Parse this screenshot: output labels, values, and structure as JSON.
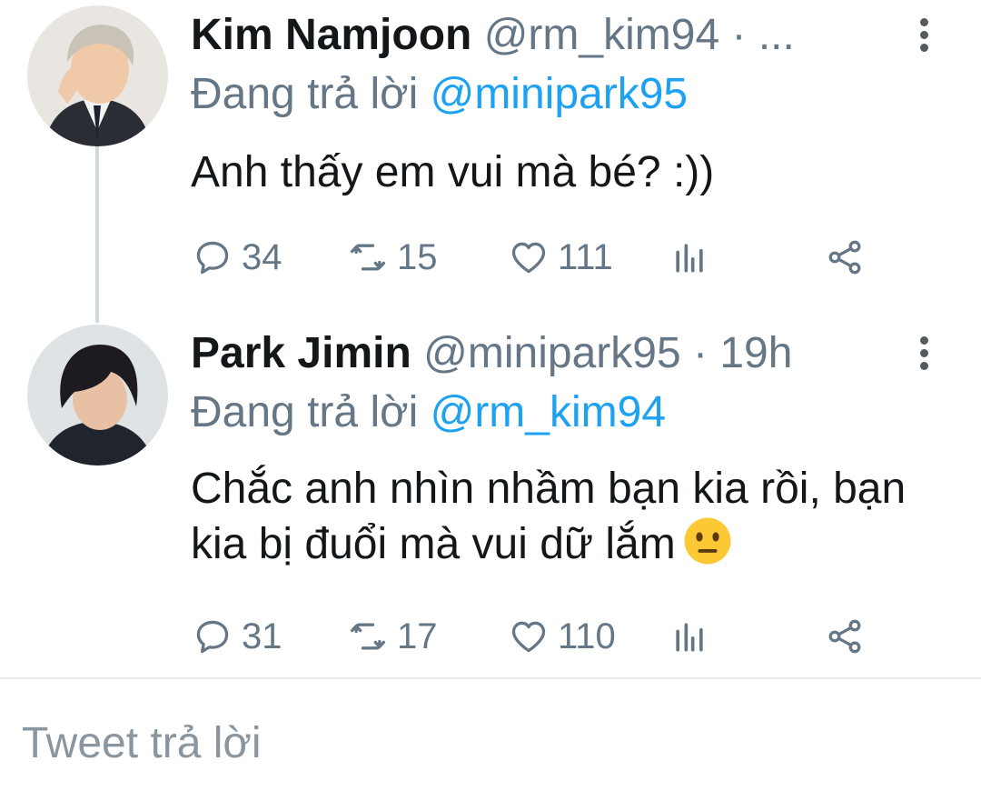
{
  "tweets": [
    {
      "name": "Kim Namjoon",
      "handle": "@rm_kim94",
      "separator": "·",
      "time": "...",
      "replying_prefix": "Đang trả lời",
      "replying_to": "@minipark95",
      "text": "Anh thấy em vui mà bé? :))",
      "replies": "34",
      "retweets": "15",
      "likes": "111"
    },
    {
      "name": "Park Jimin",
      "handle": "@minipark95",
      "separator": "·",
      "time": "19h",
      "replying_prefix": "Đang trả lời",
      "replying_to": "@rm_kim94",
      "text": "Chắc anh nhìn nhầm bạn kia rồi, bạn kia bị đuổi mà vui dữ lắm",
      "emoji": "neutral-face-emoji",
      "replies": "31",
      "retweets": "17",
      "likes": "110"
    }
  ],
  "composer": {
    "placeholder": "Tweet trả lời"
  },
  "icons": [
    "more-vertical-icon",
    "reply-icon",
    "retweet-icon",
    "like-icon",
    "analytics-icon",
    "share-icon"
  ],
  "colors": {
    "link": "#1da1f2",
    "secondary": "#657786",
    "text": "#14171a",
    "divider": "#e6ecf0"
  }
}
